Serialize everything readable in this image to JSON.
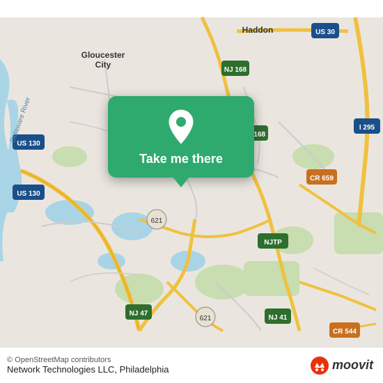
{
  "map": {
    "attribution": "© OpenStreetMap contributors",
    "bg_color": "#e8ddd0"
  },
  "popup": {
    "button_label": "Take me there",
    "icon_name": "location-pin-icon",
    "bg_color": "#2eaa6e"
  },
  "bottom_bar": {
    "copyright": "© OpenStreetMap contributors",
    "location_name": "Network Technologies LLC, Philadelphia",
    "moovit_logo_text": "moovit"
  }
}
